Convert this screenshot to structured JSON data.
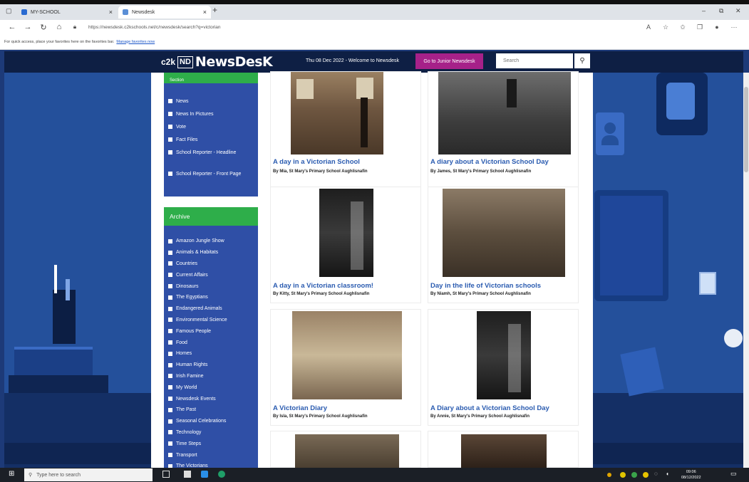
{
  "browser": {
    "tabs": [
      {
        "label": "MY-SCHOOL"
      },
      {
        "label": "Newsdesk"
      }
    ],
    "new_tab": "+",
    "url": "https://newsdesk.c2kschools.net/c/newsdesk/search?q=victorian",
    "favorites_text": "For quick access, place your favorites here on the favorites bar.",
    "favorites_link": "Manage favorites now"
  },
  "header": {
    "logo_c2k": "c2k",
    "logo_nd": "ND",
    "logo_text": "NewsDesK",
    "date_welcome": "Thu 08 Dec 2022 - Welcome to Newsdesk",
    "junior_button": "Go to Junior Newsdesk",
    "search_placeholder": "Search"
  },
  "section": {
    "heading": "Section",
    "items": [
      {
        "label": "News"
      },
      {
        "label": "News In Pictures"
      },
      {
        "label": "Vote"
      },
      {
        "label": "Fact Files"
      },
      {
        "label": "School Reporter - Headline"
      },
      {
        "label": "School Reporter - Front Page"
      }
    ]
  },
  "archive": {
    "heading": "Archive",
    "items": [
      {
        "label": "Amazon Jungle Show"
      },
      {
        "label": "Animals & Habitats"
      },
      {
        "label": "Countries"
      },
      {
        "label": "Current Affairs"
      },
      {
        "label": "Dinosaurs"
      },
      {
        "label": "The Egyptians"
      },
      {
        "label": "Endangered Animals"
      },
      {
        "label": "Environmental Science"
      },
      {
        "label": "Famous People"
      },
      {
        "label": "Food"
      },
      {
        "label": "Homes"
      },
      {
        "label": "Human Rights"
      },
      {
        "label": "Irish Famine"
      },
      {
        "label": "My World"
      },
      {
        "label": "Newsdesk Events"
      },
      {
        "label": "The Past"
      },
      {
        "label": "Seasonal Celebrations"
      },
      {
        "label": "Technology"
      },
      {
        "label": "Time Steps"
      },
      {
        "label": "Transport"
      },
      {
        "label": "The Victorians"
      }
    ]
  },
  "articles": [
    {
      "title": "A day in a Victorian School",
      "byline": "By Mia, St Mary's Primary School Aughlisnafin"
    },
    {
      "title": "A diary about a Victorian School Day",
      "byline": "By James, St Mary's Primary School Aughlisnafin"
    },
    {
      "title": "A day in a Victorian classroom!",
      "byline": "By Kitty, St Mary's Primary School Aughlisnafin"
    },
    {
      "title": "Day in the life of Victorian schools",
      "byline": "By Niamh, St Mary's Primary School Aughlisnafin"
    },
    {
      "title": "A Victorian Diary",
      "byline": "By Isla, St Mary's Primary School Aughlisnafin"
    },
    {
      "title": "A Diary about a Victorian School Day",
      "byline": "By Annie, St Mary's Primary School Aughlisnafin"
    }
  ],
  "taskbar": {
    "search_placeholder": "Type here to search",
    "time": "09:06",
    "date": "08/12/2022"
  },
  "colors": {
    "header_bg": "#0e1f44",
    "junior_button": "#a62189",
    "section_head": "#2eae4a",
    "sidebar_bg": "#2f4fa6",
    "article_title": "#2a5bb0",
    "page_bg": "#24509b"
  }
}
